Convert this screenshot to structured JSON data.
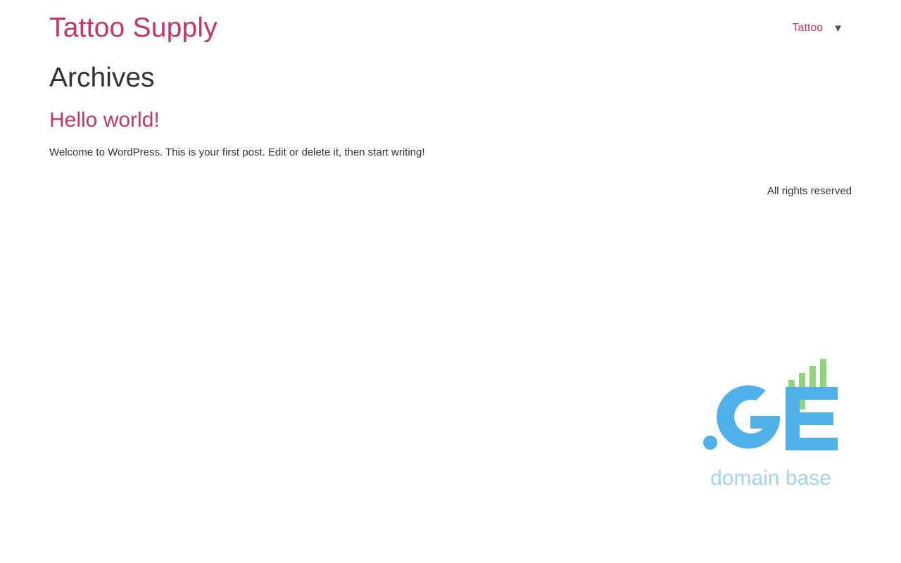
{
  "header": {
    "site_title": "Tattoo Supply",
    "nav": {
      "link_label": "Tattoo",
      "toggle_glyph": "▼"
    }
  },
  "main": {
    "archive_title": "Archives",
    "posts": [
      {
        "title": "Hello world!",
        "excerpt": "Welcome to WordPress. This is your first post. Edit or delete it, then start writing!"
      }
    ]
  },
  "footer": {
    "text": "All rights reserved"
  },
  "logo": {
    "lettering": ".GE domain base",
    "icon": "ge-domain-base-logo",
    "colors": {
      "blue": "#4fb0ea",
      "green": "#8fd47d",
      "light_blue": "#9fd4f3"
    }
  },
  "colors": {
    "accent": "#c73467",
    "text": "#333333"
  }
}
